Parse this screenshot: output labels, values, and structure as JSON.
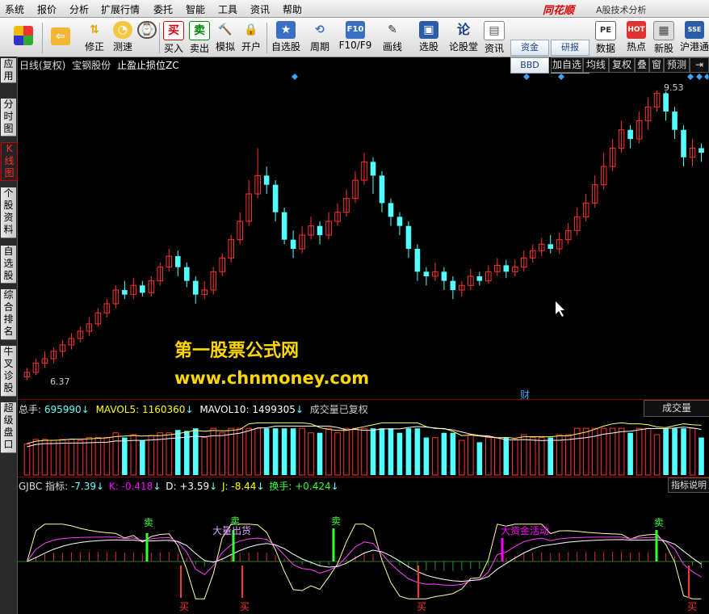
{
  "menu": {
    "items": [
      "系统",
      "报价",
      "分析",
      "扩展行情",
      "委托",
      "智能",
      "工具",
      "资讯",
      "帮助"
    ],
    "brand": "同花顺",
    "app_subtitle": "A股技术分析"
  },
  "toolbar": {
    "buttons": [
      {
        "label": "修正",
        "icon": "up-down-arrows-icon"
      },
      {
        "label": "测速",
        "icon": "clock-icon"
      },
      {
        "label": "买入",
        "icon": "buy-icon"
      },
      {
        "label": "卖出",
        "icon": "sell-icon"
      },
      {
        "label": "模拟",
        "icon": "gavel-icon"
      },
      {
        "label": "开户",
        "icon": "lock-icon"
      },
      {
        "label": "自选股",
        "icon": "star-folder-icon"
      },
      {
        "label": "周期",
        "icon": "cycle-icon"
      },
      {
        "label": "F10/F9",
        "icon": "f10-icon"
      },
      {
        "label": "画线",
        "icon": "pen-icon"
      },
      {
        "label": "选股",
        "icon": "monitor-icon"
      },
      {
        "label": "论股堂",
        "icon": "lun-icon"
      },
      {
        "label": "资讯",
        "icon": "document-icon"
      },
      {
        "label": "数据",
        "icon": "pe-icon"
      },
      {
        "label": "热点",
        "icon": "hot-icon"
      },
      {
        "label": "新股",
        "icon": "new-stock-icon"
      },
      {
        "label": "沪港通",
        "icon": "hk-connect-icon"
      }
    ],
    "small_buttons": {
      "zijin": "资金",
      "bbd": "BBD",
      "yanbao": "研报",
      "yuce": "预测"
    }
  },
  "sidebar": {
    "tabs": [
      "应用",
      "分时图",
      "K线图",
      "个股资料",
      "自选股",
      "综合排名",
      "牛叉诊股",
      "超级盘口"
    ],
    "active": "K线图"
  },
  "chart_header": {
    "period": "日线(复权)",
    "stock": "宝钢股份",
    "indicator": "止盈止损位ZC",
    "buttons": [
      "加自选",
      "均线",
      "复权",
      "叠",
      "窗",
      "预测"
    ]
  },
  "main_chart": {
    "high_label": "9.53",
    "low_label": "6.37",
    "fin_marker": "财"
  },
  "watermark": {
    "line1": "第一股票公式网",
    "line2": "www.chnmoney.com"
  },
  "volume_panel": {
    "total_label": "总手: ",
    "total_value": "695990",
    "mavol5_label": "MAVOL5: ",
    "mavol5_value": "1160360",
    "mavol10_label": "MAVOL10: ",
    "mavol10_value": "1499305",
    "note": "成交量已复权",
    "selector": "成交量"
  },
  "indicator_panel": {
    "name": "GJBC",
    "zhibiao_label": "指标: ",
    "zhibiao_value": "-7.39",
    "k_label": "K: ",
    "k_value": "-0.418",
    "d_label": "D: ",
    "d_value": "+3.59",
    "j_label": "J: ",
    "j_value": "-8.44",
    "hs_label": "换手: ",
    "hs_value": "+0.424",
    "help_button": "指标说明",
    "sell_label": "卖",
    "buy_label": "买",
    "big_out": "大量出货",
    "big_active": "大资金活动"
  },
  "chart_data": {
    "type": "candlestick",
    "price_range": [
      6.37,
      9.53
    ],
    "candles": [
      [
        6.4,
        6.45,
        6.5,
        6.37
      ],
      [
        6.45,
        6.55,
        6.6,
        6.42
      ],
      [
        6.55,
        6.6,
        6.68,
        6.5
      ],
      [
        6.6,
        6.68,
        6.72,
        6.55
      ],
      [
        6.68,
        6.75,
        6.8,
        6.62
      ],
      [
        6.75,
        6.82,
        6.88,
        6.7
      ],
      [
        6.82,
        6.9,
        6.95,
        6.78
      ],
      [
        6.9,
        6.98,
        7.05,
        6.85
      ],
      [
        6.98,
        7.1,
        7.15,
        6.95
      ],
      [
        7.1,
        7.2,
        7.25,
        7.05
      ],
      [
        7.2,
        7.35,
        7.4,
        7.15
      ],
      [
        7.35,
        7.3,
        7.45,
        7.25
      ],
      [
        7.3,
        7.4,
        7.48,
        7.25
      ],
      [
        7.4,
        7.32,
        7.45,
        7.28
      ],
      [
        7.32,
        7.45,
        7.5,
        7.28
      ],
      [
        7.45,
        7.6,
        7.65,
        7.4
      ],
      [
        7.6,
        7.72,
        7.8,
        7.55
      ],
      [
        7.72,
        7.6,
        7.78,
        7.5
      ],
      [
        7.6,
        7.45,
        7.65,
        7.38
      ],
      [
        7.45,
        7.3,
        7.5,
        7.2
      ],
      [
        7.3,
        7.35,
        7.45,
        7.25
      ],
      [
        7.35,
        7.55,
        7.6,
        7.3
      ],
      [
        7.55,
        7.7,
        7.75,
        7.5
      ],
      [
        7.7,
        7.9,
        7.95,
        7.65
      ],
      [
        7.9,
        8.1,
        8.2,
        7.85
      ],
      [
        8.1,
        8.4,
        8.55,
        8.05
      ],
      [
        8.4,
        8.6,
        8.9,
        8.35
      ],
      [
        8.6,
        8.5,
        8.7,
        8.4
      ],
      [
        8.5,
        8.2,
        8.55,
        8.1
      ],
      [
        8.2,
        7.9,
        8.25,
        7.85
      ],
      [
        7.9,
        7.8,
        8.0,
        7.7
      ],
      [
        7.8,
        7.95,
        8.05,
        7.75
      ],
      [
        7.95,
        8.05,
        8.15,
        7.9
      ],
      [
        8.05,
        7.95,
        8.1,
        7.85
      ],
      [
        7.95,
        8.1,
        8.2,
        7.9
      ],
      [
        8.1,
        8.2,
        8.3,
        8.05
      ],
      [
        8.2,
        8.35,
        8.45,
        8.15
      ],
      [
        8.35,
        8.55,
        8.65,
        8.3
      ],
      [
        8.55,
        8.75,
        8.85,
        8.5
      ],
      [
        8.75,
        8.6,
        8.8,
        8.4
      ],
      [
        8.6,
        8.3,
        8.65,
        8.2
      ],
      [
        8.3,
        8.15,
        8.35,
        8.05
      ],
      [
        8.15,
        8.05,
        8.2,
        7.95
      ],
      [
        8.05,
        7.8,
        8.1,
        7.7
      ],
      [
        7.8,
        7.55,
        7.85,
        7.45
      ],
      [
        7.55,
        7.5,
        7.6,
        7.4
      ],
      [
        7.5,
        7.55,
        7.65,
        7.45
      ],
      [
        7.55,
        7.45,
        7.6,
        7.35
      ],
      [
        7.45,
        7.35,
        7.5,
        7.25
      ],
      [
        7.35,
        7.4,
        7.45,
        7.28
      ],
      [
        7.4,
        7.5,
        7.58,
        7.35
      ],
      [
        7.5,
        7.45,
        7.55,
        7.4
      ],
      [
        7.45,
        7.55,
        7.62,
        7.42
      ],
      [
        7.55,
        7.62,
        7.7,
        7.5
      ],
      [
        7.62,
        7.55,
        7.68,
        7.48
      ],
      [
        7.55,
        7.6,
        7.68,
        7.5
      ],
      [
        7.6,
        7.7,
        7.78,
        7.55
      ],
      [
        7.7,
        7.78,
        7.85,
        7.65
      ],
      [
        7.78,
        7.85,
        7.92,
        7.72
      ],
      [
        7.85,
        7.8,
        7.95,
        7.75
      ],
      [
        7.8,
        7.9,
        7.98,
        7.75
      ],
      [
        7.9,
        8.0,
        8.08,
        7.85
      ],
      [
        8.0,
        8.15,
        8.25,
        7.95
      ],
      [
        8.15,
        8.3,
        8.4,
        8.1
      ],
      [
        8.3,
        8.5,
        8.6,
        8.25
      ],
      [
        8.5,
        8.7,
        8.85,
        8.45
      ],
      [
        8.7,
        8.9,
        9.0,
        8.65
      ],
      [
        8.9,
        9.1,
        9.2,
        8.85
      ],
      [
        9.1,
        9.0,
        9.15,
        8.9
      ],
      [
        9.0,
        9.2,
        9.3,
        8.95
      ],
      [
        9.2,
        9.35,
        9.45,
        9.1
      ],
      [
        9.35,
        9.5,
        9.53,
        9.3
      ],
      [
        9.5,
        9.3,
        9.52,
        9.2
      ],
      [
        9.3,
        9.1,
        9.35,
        9.0
      ],
      [
        9.1,
        8.8,
        9.15,
        8.7
      ],
      [
        8.8,
        8.9,
        9.0,
        8.7
      ],
      [
        8.9,
        8.85,
        8.95,
        8.75
      ]
    ]
  }
}
